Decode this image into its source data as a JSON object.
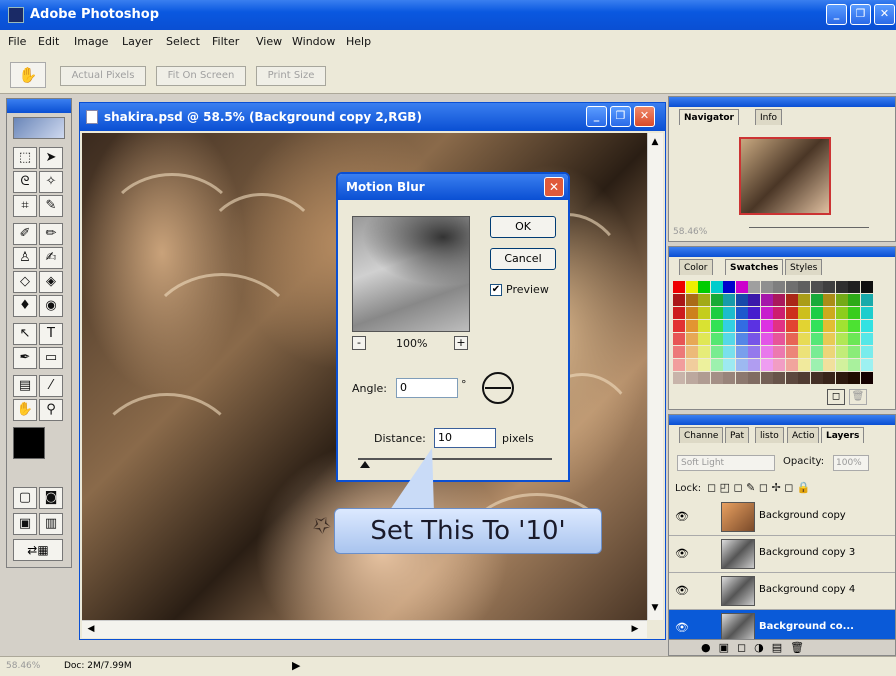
{
  "app": {
    "title": "Adobe Photoshop",
    "window_buttons": [
      "_",
      "❐",
      "✕"
    ]
  },
  "menu": [
    "File",
    "Edit",
    "Image",
    "Layer",
    "Select",
    "Filter",
    "View",
    "Window",
    "Help"
  ],
  "options_bar": {
    "tool_icon": "hand-icon",
    "buttons": [
      "Actual Pixels",
      "Fit On Screen",
      "Print Size"
    ]
  },
  "document": {
    "title": "shakira.psd @ 58.5% (Background copy 2,RGB)"
  },
  "dialog": {
    "title": "Motion Blur",
    "ok_label": "OK",
    "cancel_label": "Cancel",
    "preview_label": "Preview",
    "preview_checked": true,
    "zoom_minus": "-",
    "zoom_plus": "+",
    "zoom_value": "100%",
    "angle_label": "Angle:",
    "angle_value": "0",
    "angle_unit": "°",
    "distance_label": "Distance:",
    "distance_value": "10",
    "distance_unit": "pixels"
  },
  "callout": {
    "text": "Set This To '10'"
  },
  "navigator": {
    "tabs": [
      "Navigator",
      "Info"
    ],
    "zoom": "58.46%"
  },
  "swatches": {
    "tabs": [
      "Color",
      "Swatches",
      "Styles"
    ]
  },
  "layers": {
    "tabs": [
      "Channe",
      "Pat",
      "listo",
      "Actio",
      "Layers"
    ],
    "blend_mode": "Soft Light",
    "opacity_label": "Opacity:",
    "opacity_value": "100%",
    "lock_label": "Lock:",
    "rows": [
      {
        "name": "Background copy",
        "selected": false
      },
      {
        "name": "Background copy 3",
        "selected": false
      },
      {
        "name": "Background copy 4",
        "selected": false
      },
      {
        "name": "Background co...",
        "selected": true
      }
    ]
  },
  "status": {
    "zoom": "58.46%",
    "doc": "Doc: 2M/7.99M"
  }
}
